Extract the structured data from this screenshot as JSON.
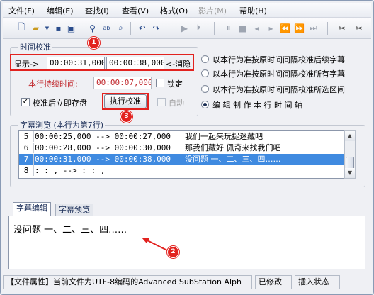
{
  "menu": [
    "文件(F)",
    "编辑(E)",
    "查找(I)",
    "查看(V)",
    "格式(O)",
    "影片(M)",
    "帮助(H)"
  ],
  "menu_disabled": [
    false,
    false,
    false,
    false,
    false,
    true,
    false
  ],
  "timing": {
    "group_title": "时间校准",
    "display_label": "显示->",
    "start_time": "00:00:31,000",
    "end_time": "00:00:38,000",
    "cancel_label": "<-消隐",
    "duration_label": "本行持续时间:",
    "duration_value": "00:00:07,000",
    "lock_label": "锁定",
    "save_after_label": "校准后立即存盘",
    "execute_label": "执行校准",
    "auto_label": "自动"
  },
  "options": [
    "以本行为准按原时间间隔校准后续字幕",
    "以本行为准按原时间间隔校准所有字幕",
    "以本行为准按原时间间隔校准所选区间",
    "编 辑 制 作 本 行 时 间 轴"
  ],
  "browse": {
    "group_title": "字幕浏览 (本行为第7行)",
    "rows": [
      {
        "num": "5",
        "time": "00:00:25,000 --> 00:00:27,000",
        "text": "我们一起来玩捉迷藏吧"
      },
      {
        "num": "6",
        "time": "00:00:28,000 --> 00:00:30,000",
        "text": "那我们藏好 佩奇来找我们吧"
      },
      {
        "num": "7",
        "time": "00:00:31,000 --> 00:00:38,000",
        "text": "没问题 一、二、三、四……"
      },
      {
        "num": "8",
        "time": "  :  :  ,     -->   :  :  ,",
        "text": ""
      }
    ]
  },
  "tabs": [
    "字幕编辑",
    "字幕预览"
  ],
  "editor_text": "没问题 一、二、三、四……",
  "status": {
    "file_info": "【文件属性】当前文件为UTF-8编码的Advanced SubStation Alph",
    "modified": "已修改",
    "mode": "插入状态"
  },
  "callouts": [
    "1",
    "2",
    "3"
  ],
  "colors": {
    "accent_red": "#e2221f",
    "selection": "#3f8ae0",
    "duration_text": "#c0262b"
  }
}
